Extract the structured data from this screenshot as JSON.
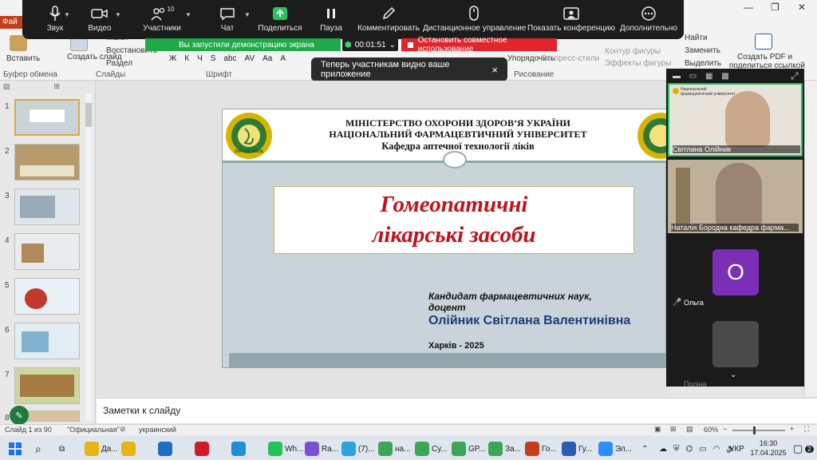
{
  "ribbon": {
    "file_tab": "Фай",
    "paste": "Вставить",
    "create_slide": "Создать слайд",
    "layout": "Макет",
    "restore": "Восстановить",
    "section": "Раздел",
    "font_group": "Шрифт",
    "clipboard_group": "Буфер обмена",
    "slides_group": "Слайды",
    "drawing_group": "Рисование",
    "arrange": "Упорядочить",
    "express_styles": "Экспресс-стили",
    "shape_outline": "Контур фигуры",
    "shape_effects": "Эффекты фигуры",
    "find": "Найти",
    "replace": "Заменить",
    "select": "Выделить",
    "create_pdf_1": "Создать PDF и",
    "create_pdf_2": "поделиться ссылкой",
    "font_buttons": [
      "Ж",
      "К",
      "Ч",
      "S",
      "abc",
      "AV",
      "Aa",
      "A"
    ]
  },
  "zoom": {
    "buttons": [
      {
        "label": "Звук",
        "icon": "microphone-icon"
      },
      {
        "label": "Видео",
        "icon": "video-camera-icon"
      },
      {
        "label": "Участники",
        "icon": "participants-icon",
        "count": "10"
      },
      {
        "label": "Чат",
        "icon": "chat-icon"
      },
      {
        "label": "Поделиться",
        "icon": "share-screen-icon"
      },
      {
        "label": "Пауза",
        "icon": "pause-icon"
      },
      {
        "label": "Комментировать",
        "icon": "annotate-icon"
      },
      {
        "label": "Дистанционное управление",
        "icon": "remote-control-icon"
      },
      {
        "label": "Показать конференцию",
        "icon": "show-meeting-icon"
      },
      {
        "label": "Дополнительно",
        "icon": "more-icon"
      }
    ],
    "share_status": "Вы запустили демонстрацию экрана",
    "timer": "00:01:51",
    "stop_share": "Остановить совместное использование",
    "toast": "Теперь участникам видно ваше приложение",
    "toast_close": "×"
  },
  "thumbs": [
    "1",
    "2",
    "3",
    "4",
    "5",
    "6",
    "7",
    "8"
  ],
  "slide": {
    "ministry": "МІНІСТЕРСТВО  ОХОРОНИ  ЗДОРОВ’Я УКРАЇНИ",
    "university": "НАЦІОНАЛЬНИЙ  ФАРМАЦЕВТИЧНИЙ  УНІВЕРСИТЕТ",
    "department": "Кафедра аптечної технології ліків",
    "title_line1": "Гомеопатичні",
    "title_line2": "лікарські засоби",
    "degree_line1": "Кандидат фармацевтичних  наук,",
    "degree_line2": "доцент",
    "author": "Олійник Світлана Валентинівна",
    "city_year": "Харків - 2025",
    "logo_text": "SAPERE AUDE"
  },
  "notes_placeholder": "Заметки к слайду",
  "status": {
    "slide_info": "Слайд 1 из 90",
    "theme": "\"Официальная\"",
    "language": "украинский",
    "zoom": "60%"
  },
  "video": {
    "header_text": "Національний фармацевтичний університет",
    "p1": "Світлана Олійник",
    "p2": "Наталія Бородна кафедра фарма...",
    "p3_initial": "О",
    "p3": "Ольга",
    "p4": "Поліна"
  },
  "taskbar": {
    "items": [
      {
        "label": "Да...",
        "icon": "folder-icon",
        "color": "#e7b416"
      },
      {
        "label": "",
        "icon": "folder-icon",
        "color": "#e7b416"
      },
      {
        "label": "",
        "icon": "outlook-icon",
        "color": "#1f6ec2"
      },
      {
        "label": "",
        "icon": "opera-icon",
        "color": "#d11b2a"
      },
      {
        "label": "",
        "icon": "edge-icon",
        "color": "#1d8fd6"
      },
      {
        "label": "Wh...",
        "icon": "whatsapp-icon",
        "color": "#25c15b"
      },
      {
        "label": "Ra...",
        "icon": "viber-icon",
        "color": "#7b4fd1"
      },
      {
        "label": "(7)...",
        "icon": "telegram-icon",
        "color": "#2aa3de"
      },
      {
        "label": "на...",
        "icon": "chrome-icon",
        "color": "#3ca556"
      },
      {
        "label": "Су...",
        "icon": "chrome-icon",
        "color": "#3ca556"
      },
      {
        "label": "GP...",
        "icon": "chrome-icon",
        "color": "#3ca556"
      },
      {
        "label": "За...",
        "icon": "chrome-icon",
        "color": "#3ca556"
      },
      {
        "label": "Го...",
        "icon": "powerpoint-icon",
        "color": "#c43e1c"
      },
      {
        "label": "Гу...",
        "icon": "word-icon",
        "color": "#2b5cad"
      },
      {
        "label": "Эл...",
        "icon": "zoom-icon",
        "color": "#2d8cff"
      }
    ],
    "lang": "УКР",
    "time": "16:30",
    "date": "17.04.2025",
    "notif_count": "2"
  }
}
